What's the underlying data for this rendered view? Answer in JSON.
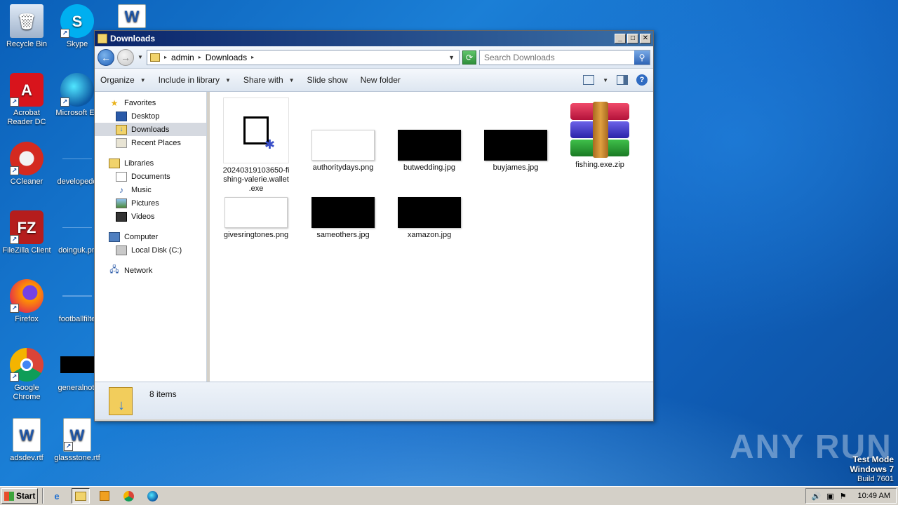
{
  "desktop": {
    "icons": [
      {
        "label": "Recycle Bin"
      },
      {
        "label": "Skype"
      },
      {
        "label": "Acrobat Reader DC"
      },
      {
        "label": "Microsoft Ed"
      },
      {
        "label": "CCleaner"
      },
      {
        "label": "developedd"
      },
      {
        "label": "FileZilla Client"
      },
      {
        "label": "doinguk.pn"
      },
      {
        "label": "Firefox"
      },
      {
        "label": "footballfilte"
      },
      {
        "label": "Google Chrome"
      },
      {
        "label": "generalnot."
      },
      {
        "label": "adsdev.rtf"
      },
      {
        "label": "glassstone.rtf"
      }
    ],
    "watermark": "ANY RUN",
    "testmode": {
      "line1": "Test Mode",
      "line2": "Windows 7",
      "line3": "Build 7601"
    }
  },
  "window": {
    "title": "Downloads",
    "buttons": {
      "minimize": "_",
      "maximize": "□",
      "close": "✕"
    },
    "address": {
      "crumbs": [
        "admin",
        "Downloads"
      ]
    },
    "search": {
      "placeholder": "Search Downloads"
    },
    "toolbar": {
      "organize": "Organize",
      "include_library": "Include in library",
      "share_with": "Share with",
      "slide_show": "Slide show",
      "new_folder": "New folder"
    },
    "nav": {
      "favorites": "Favorites",
      "desktop": "Desktop",
      "downloads": "Downloads",
      "recent_places": "Recent Places",
      "libraries": "Libraries",
      "documents": "Documents",
      "music": "Music",
      "pictures": "Pictures",
      "videos": "Videos",
      "computer": "Computer",
      "local_disk": "Local Disk (C:)",
      "network": "Network"
    },
    "files": [
      {
        "name": "20240319103650-fishing-valerie.wallet.exe",
        "name_lines": [
          "20240319103650-fi",
          "shing-valerie.wallet",
          ".exe"
        ],
        "kind": "exe"
      },
      {
        "name": "authoritydays.png",
        "kind": "white"
      },
      {
        "name": "butwedding.jpg",
        "kind": "black"
      },
      {
        "name": "buyjames.jpg",
        "kind": "black"
      },
      {
        "name": "fishing.exe.zip",
        "kind": "zip"
      },
      {
        "name": "givesringtones.png",
        "kind": "white"
      },
      {
        "name": "sameothers.jpg",
        "kind": "black"
      },
      {
        "name": "xamazon.jpg",
        "kind": "black"
      }
    ],
    "status": {
      "count": "8 items"
    }
  },
  "taskbar": {
    "start": "Start",
    "time": "10:49 AM"
  }
}
